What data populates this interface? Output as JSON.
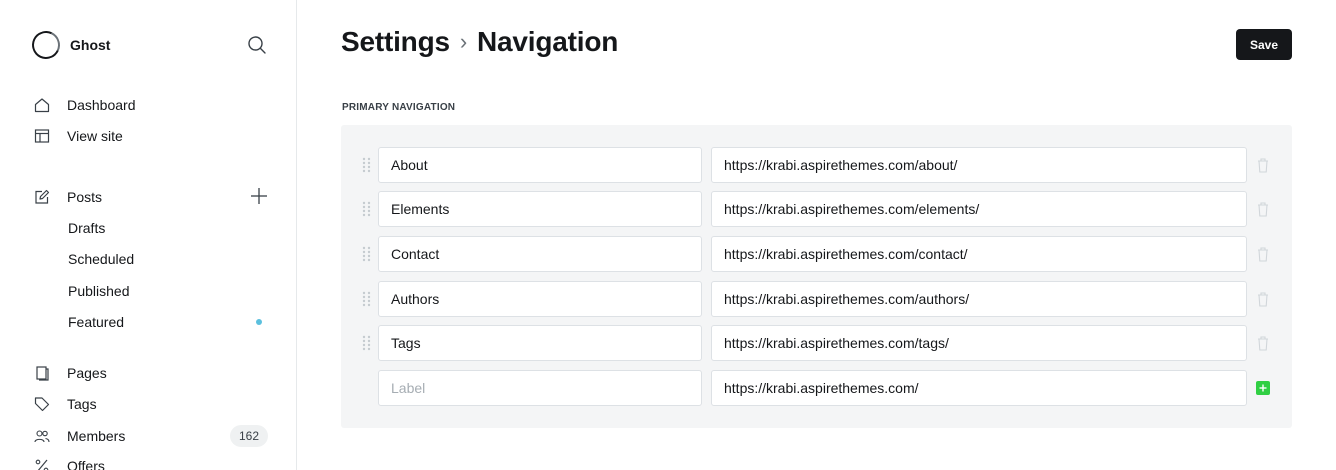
{
  "sidebar": {
    "brand": "Ghost",
    "main_items": [
      {
        "label": "Dashboard",
        "icon": "home-icon"
      },
      {
        "label": "View site",
        "icon": "layout-icon"
      }
    ],
    "posts": {
      "label": "Posts",
      "icon": "edit-icon"
    },
    "post_subitems": [
      "Drafts",
      "Scheduled",
      "Published",
      "Featured"
    ],
    "featured_dot_color": "#5bc0de",
    "other_items": [
      {
        "label": "Pages",
        "icon": "page-icon"
      },
      {
        "label": "Tags",
        "icon": "tag-icon"
      },
      {
        "label": "Members",
        "icon": "members-icon",
        "count": "162"
      },
      {
        "label": "Offers",
        "icon": "percent-icon"
      }
    ]
  },
  "header": {
    "breadcrumb_parent": "Settings",
    "breadcrumb_separator": "›",
    "breadcrumb_current": "Navigation",
    "save_label": "Save"
  },
  "section": {
    "label": "PRIMARY NAVIGATION"
  },
  "navigation_items": [
    {
      "label": "About",
      "url": "https://krabi.aspirethemes.com/about/"
    },
    {
      "label": "Elements",
      "url": "https://krabi.aspirethemes.com/elements/"
    },
    {
      "label": "Contact",
      "url": "https://krabi.aspirethemes.com/contact/"
    },
    {
      "label": "Authors",
      "url": "https://krabi.aspirethemes.com/authors/"
    },
    {
      "label": "Tags",
      "url": "https://krabi.aspirethemes.com/tags/"
    }
  ],
  "new_item": {
    "label_placeholder": "Label",
    "url_value": "https://krabi.aspirethemes.com/"
  },
  "colors": {
    "accent_green": "#30cf43",
    "dark": "#15171a"
  }
}
